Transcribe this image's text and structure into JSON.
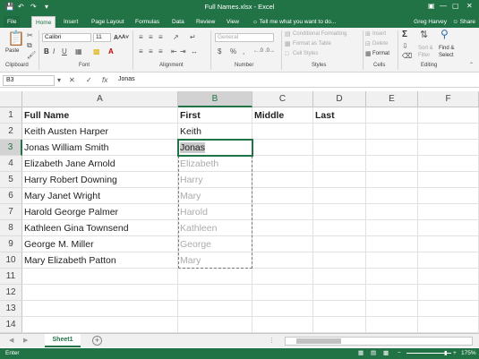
{
  "window": {
    "title": "Full Names.xlsx - Excel",
    "user": "Greg Harvey",
    "share_label": "Share"
  },
  "quick_access": {
    "save_icon": "save-icon",
    "undo_icon": "undo-icon",
    "redo_icon": "redo-icon"
  },
  "tabs": [
    "File",
    "Home",
    "Insert",
    "Page Layout",
    "Formulas",
    "Data",
    "Review",
    "View"
  ],
  "active_tab": "Home",
  "tell_me": "Tell me what you want to do...",
  "ribbon": {
    "clipboard": {
      "paste": "Paste",
      "label": "Clipboard"
    },
    "font": {
      "name": "Calibri",
      "size": "11",
      "label": "Font",
      "bold": "B",
      "italic": "I",
      "underline": "U",
      "grow": "A˄",
      "shrink": "A˅",
      "font_color": "A"
    },
    "alignment": {
      "label": "Alignment"
    },
    "number": {
      "format": "General",
      "label": "Number",
      "currency": "$",
      "percent": "%",
      "comma": ","
    },
    "styles": {
      "conditional": "Conditional Formatting",
      "table": "Format as Table",
      "cell_styles": "Cell Styles",
      "label": "Styles"
    },
    "cells": {
      "insert": "Insert",
      "delete": "Delete",
      "format": "Format",
      "label": "Cells"
    },
    "editing": {
      "sum": "Σ",
      "sort": "Sort &",
      "filter": "Filter",
      "find": "Find &",
      "select": "Select",
      "label": "Editing"
    }
  },
  "formula_bar": {
    "name_box": "B3",
    "cancel": "✕",
    "enter": "✓",
    "fx": "fx",
    "value": "Jonas"
  },
  "columns": [
    "A",
    "B",
    "C",
    "D",
    "E",
    "F"
  ],
  "rows": [
    "1",
    "2",
    "3",
    "4",
    "5",
    "6",
    "7",
    "8",
    "9",
    "10",
    "11",
    "12",
    "13",
    "14"
  ],
  "cells": {
    "A1": "Full Name",
    "B1": "First",
    "C1": "Middle",
    "D1": "Last",
    "A2": "Keith Austen Harper",
    "B2": "Keith",
    "A3": "Jonas William Smith",
    "B3": "Jonas",
    "A4": "Elizabeth Jane Arnold",
    "B4": "Elizabeth",
    "A5": "Harry Robert Downing",
    "B5": "Harry",
    "A6": "Mary Janet Wright",
    "B6": "Mary",
    "A7": "Harold George Palmer",
    "B7": "Harold",
    "A8": "Kathleen Gina Townsend",
    "B8": "Kathleen",
    "A9": "George M. Miller",
    "B9": "George",
    "A10": "Mary Elizabeth Patton",
    "B10": "Mary"
  },
  "sheet": {
    "tab": "Sheet1",
    "add": "+"
  },
  "status": {
    "mode": "Enter",
    "zoom": "175%"
  }
}
